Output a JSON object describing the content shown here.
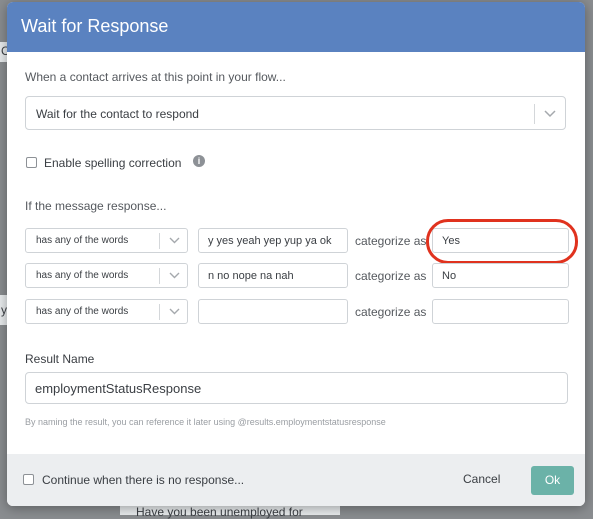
{
  "background": {
    "tile_text": "C",
    "side_text": "y",
    "footer_text": "Have you been unemployed for"
  },
  "modal": {
    "title": "Wait for Response",
    "arrival_label": "When a contact arrives at this point in your flow...",
    "mode_select_value": "Wait for the contact to respond",
    "spelling_label": "Enable spelling correction",
    "spelling_checked": false,
    "response_label": "If the message response...",
    "rules": [
      {
        "operator": "has any of the words",
        "arguments": "y yes yeah yep yup ya ok",
        "category_label": "categorize as",
        "category": "Yes",
        "highlighted": true
      },
      {
        "operator": "has any of the words",
        "arguments": "n no nope na nah",
        "category_label": "categorize as",
        "category": "No",
        "highlighted": false
      },
      {
        "operator": "has any of the words",
        "arguments": "",
        "category_label": "categorize as",
        "category": "",
        "highlighted": false
      }
    ],
    "result_name_label": "Result Name",
    "result_name_value": "employmentStatusResponse",
    "result_hint": "By naming the result, you can reference it later using @results.employmentstatusresponse",
    "continue_label": "Continue when there is no response...",
    "continue_checked": false,
    "cancel_label": "Cancel",
    "ok_label": "Ok"
  },
  "colors": {
    "header": "#5a82c0",
    "ok_button": "#6bb2a8",
    "highlight_ring": "#e0321e",
    "overlay": "#8a8d90"
  },
  "icons": [
    "chevron-down-icon",
    "info-icon"
  ]
}
